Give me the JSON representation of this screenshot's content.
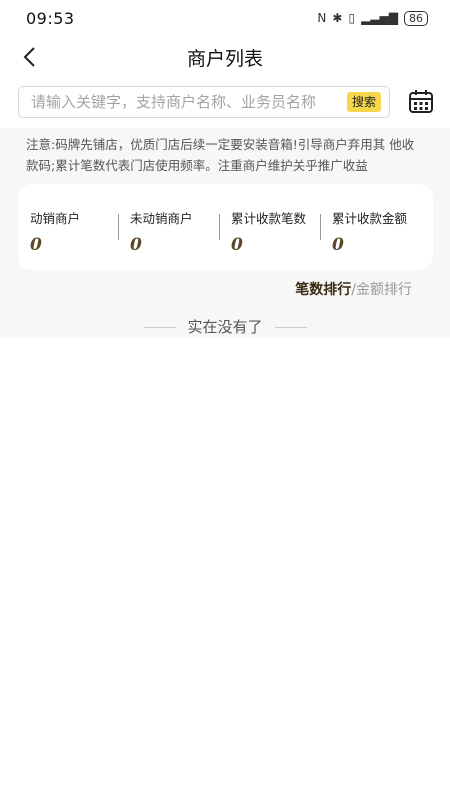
{
  "status_bar": {
    "time": "09:53",
    "battery": "86"
  },
  "header": {
    "title": "商户列表"
  },
  "search": {
    "placeholder": "请输入关键字，支持商户名称、业务员名称",
    "button_label": "搜索"
  },
  "notice": "注意:码牌先铺店，优质门店后续一定要安装音箱!引导商户弃用其 他收款码;累计笔数代表门店使用频率。注重商户维护关乎推广收益",
  "stats": [
    {
      "label": "动销商户",
      "value": "0"
    },
    {
      "label": "未动销商户",
      "value": "0"
    },
    {
      "label": "累计收款笔数",
      "value": "0"
    },
    {
      "label": "累计收款金额",
      "value": "0"
    }
  ],
  "sort": {
    "by_count": "笔数排行",
    "separator": "/",
    "by_amount": "金额排行"
  },
  "list_end": "实在没有了",
  "colors": {
    "accent_yellow": "#f6d64a",
    "sort_active": "#3a2c12",
    "value_brown": "#5b4a2a"
  }
}
